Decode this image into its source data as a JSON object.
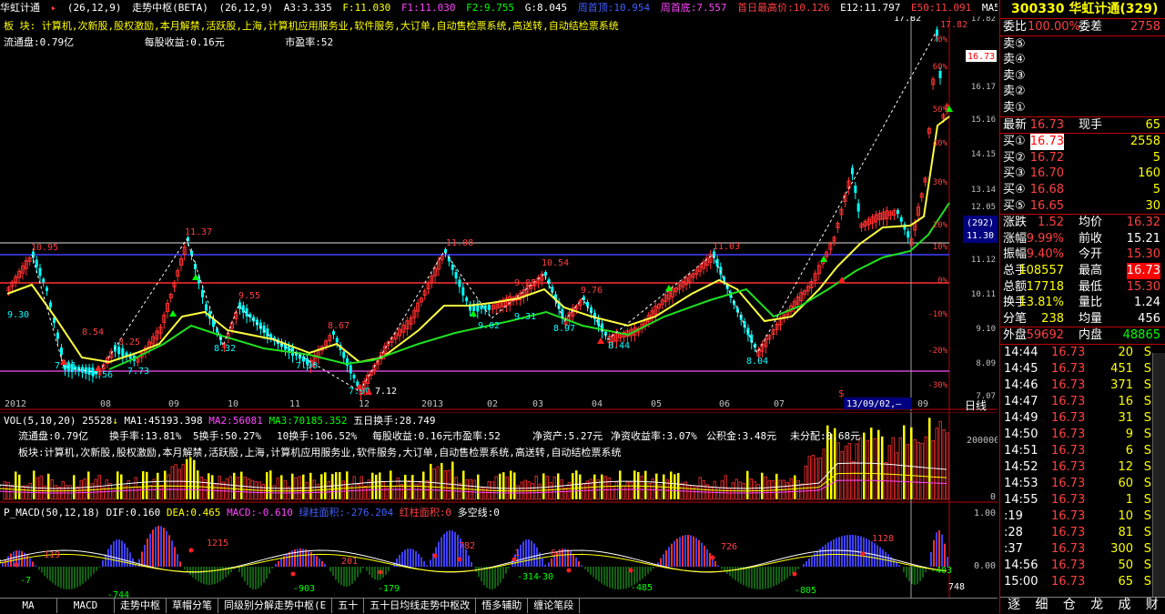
{
  "header": {
    "stock_name": "华虹计通",
    "params": "(26,12,9)",
    "indicator": "走势中枢(BETA)",
    "indicator_params": "(26,12,9)",
    "a3": "A3:3.335",
    "f": "F:11.030",
    "f1": "F1:11.030",
    "f2": "F2:9.755",
    "g": "G:8.045",
    "week_top": "周首顶:10.954",
    "week_bottom": "周首底:7.557",
    "day_high": "首日最高价:10.126",
    "e12": "E12:11.797",
    "e50": "E50:11.091",
    "ma5": "MA5"
  },
  "info": {
    "sector_label": "板  块:",
    "sector_text": "计算机,次新股,股权激励,本月解禁,活跃股,上海,计算机应用服务业,软件服务,大订单,自动售检票系统,高送转,自动结检票系统",
    "float_cap": "流通盘:0.79亿",
    "eps": "每股收益:0.16元",
    "pe": "市盈率:52"
  },
  "main_chart": {
    "right_labels_pct": [
      "70%",
      "60%",
      "50%",
      "40%",
      "30%",
      "20%",
      "10%",
      "0%",
      "-10%",
      "-20%",
      "-30%"
    ],
    "right_labels_price": [
      "17.82",
      "16.73",
      "16.17",
      "15.16",
      "14.15",
      "13.14",
      "12.05",
      "11.30",
      "11.12",
      "10.11",
      "9.10",
      "8.09",
      "7.07"
    ],
    "price_tag": "16.73",
    "box_292": "(292)",
    "box_1130": "11.30",
    "peak_labels": [
      "10.95",
      "9.30",
      "7.81",
      "7.56",
      "8.54",
      "8.25",
      "7.73",
      "11.37",
      "8.32",
      "9.55",
      "7.90",
      "8.67",
      "7.90",
      "7.12",
      "11.08",
      "9.02",
      "9.85",
      "9.31",
      "10.54",
      "8.97",
      "9.76",
      "8.44",
      "11.03",
      "8.04",
      "17.82",
      "17.82"
    ],
    "x_labels": [
      "2012",
      "08",
      "09",
      "10",
      "11",
      "12",
      "2013",
      "02",
      "03",
      "04",
      "05",
      "06",
      "07",
      "13/09/02,—",
      "09"
    ],
    "day_line": "日线",
    "dollar": "$"
  },
  "volume": {
    "head": "VOL(5,10,20)",
    "v": "25528",
    "ma1": "MA1:45193.398",
    "ma2": "MA2:56081",
    "ma3": "MA3:70185.352",
    "five_day": "五日换手:28.749",
    "row1": [
      "流通盘:0.79亿",
      "换手率:13.81%",
      "5换手:50.27%",
      "10换手:106.52%",
      "每股收益:0.16元",
      "市盈率:52",
      "净资产:5.27元",
      "净资收益率:3.07%",
      "公积金:3.48元",
      "未分配:0.68元"
    ],
    "row2": "板块:计算机,次新股,股权激励,本月解禁,活跃股,上海,计算机应用服务业,软件服务,大订单,自动售检票系统,高送转,自动结检票系统",
    "scale_top": "200000",
    "scale_bottom": "0"
  },
  "macd": {
    "head": "P_MACD(50,12,18)",
    "dif": "DIF:0.160",
    "dea": "DEA:0.465",
    "macd": "MACD:-0.610",
    "green_area": "绿柱面积:-276.204",
    "red_area": "红柱面积:0",
    "bull_bear": "多空线:0",
    "labels": [
      "119",
      "-7",
      "1215",
      "-744",
      "201",
      "-903",
      "-179",
      "782",
      "1",
      "64",
      "-314",
      "-30",
      "-485",
      "726",
      "-805",
      "1128",
      "-403",
      "748"
    ],
    "scale": [
      "0.00",
      "1.00"
    ]
  },
  "bottom_tabs": [
    "MA",
    "MACD",
    "走势中枢",
    "草帽分笔",
    "同级别分解走势中枢(E",
    "五十",
    "五十日均线走势中枢改",
    "悟多辅助",
    "缠论笔段"
  ],
  "quote": {
    "code": "300330",
    "name": "华虹计通",
    "count": "(329)",
    "wb_label": "委比",
    "wb_value": "100.00%",
    "wc_label": "委差",
    "wc_value": "2758",
    "sells": [
      "卖⑤",
      "卖④",
      "卖③",
      "卖②",
      "卖①"
    ],
    "last_label": "最新",
    "last": "16.73",
    "now_label": "现手",
    "now": "65",
    "buys": [
      {
        "label": "买①",
        "price": "16.73",
        "vol": "2558"
      },
      {
        "label": "买②",
        "price": "16.72",
        "vol": "5"
      },
      {
        "label": "买③",
        "price": "16.70",
        "vol": "160"
      },
      {
        "label": "买④",
        "price": "16.68",
        "vol": "5"
      },
      {
        "label": "买⑤",
        "price": "16.65",
        "vol": "30"
      }
    ],
    "stats": [
      {
        "l1": "涨跌",
        "v1": "1.52",
        "l2": "均价",
        "v2": "16.32"
      },
      {
        "l1": "涨幅",
        "v1": "9.99%",
        "l2": "前收",
        "v2": "15.21"
      },
      {
        "l1": "振幅",
        "v1": "9.40%",
        "l2": "今开",
        "v2": "15.30"
      },
      {
        "l1": "总手",
        "v1": "108557",
        "l2": "最高",
        "v2": "16.73"
      },
      {
        "l1": "总额",
        "v1": "17718",
        "l2": "最低",
        "v2": "15.30"
      },
      {
        "l1": "换手",
        "v1": "13.81%",
        "l2": "量比",
        "v2": "1.24"
      },
      {
        "l1": "分笔",
        "v1": "238",
        "l2": "均量",
        "v2": "456"
      }
    ],
    "outer_label": "外盘",
    "outer": "59692",
    "inner_label": "内盘",
    "inner": "48865"
  },
  "ticks": [
    {
      "t": "14:44",
      "p": "16.73",
      "v": "20",
      "d": "S"
    },
    {
      "t": "14:45",
      "p": "16.73",
      "v": "451",
      "d": "S"
    },
    {
      "t": "14:46",
      "p": "16.73",
      "v": "371",
      "d": "S"
    },
    {
      "t": "14:47",
      "p": "16.73",
      "v": "16",
      "d": "S"
    },
    {
      "t": "14:49",
      "p": "16.73",
      "v": "31",
      "d": "S"
    },
    {
      "t": "14:50",
      "p": "16.73",
      "v": "9",
      "d": "S"
    },
    {
      "t": "14:51",
      "p": "16.73",
      "v": "6",
      "d": "S"
    },
    {
      "t": "14:52",
      "p": "16.73",
      "v": "12",
      "d": "S"
    },
    {
      "t": "14:53",
      "p": "16.73",
      "v": "60",
      "d": "S"
    },
    {
      "t": "14:55",
      "p": "16.73",
      "v": "1",
      "d": "S"
    },
    {
      "t": ":19",
      "p": "16.73",
      "v": "10",
      "d": "S"
    },
    {
      "t": ":28",
      "p": "16.73",
      "v": "81",
      "d": "S"
    },
    {
      "t": ":37",
      "p": "16.73",
      "v": "300",
      "d": "S"
    },
    {
      "t": "14:56",
      "p": "16.73",
      "v": "50",
      "d": "S"
    },
    {
      "t": "15:00",
      "p": "16.73",
      "v": "65",
      "d": "S"
    }
  ],
  "bottom_icons": [
    "逐",
    "细",
    "仓",
    "龙",
    "成",
    "财"
  ],
  "colors": {
    "up": "#ff4040",
    "down": "#00ff00",
    "accent": "#ffff00",
    "bg": "#000000"
  }
}
